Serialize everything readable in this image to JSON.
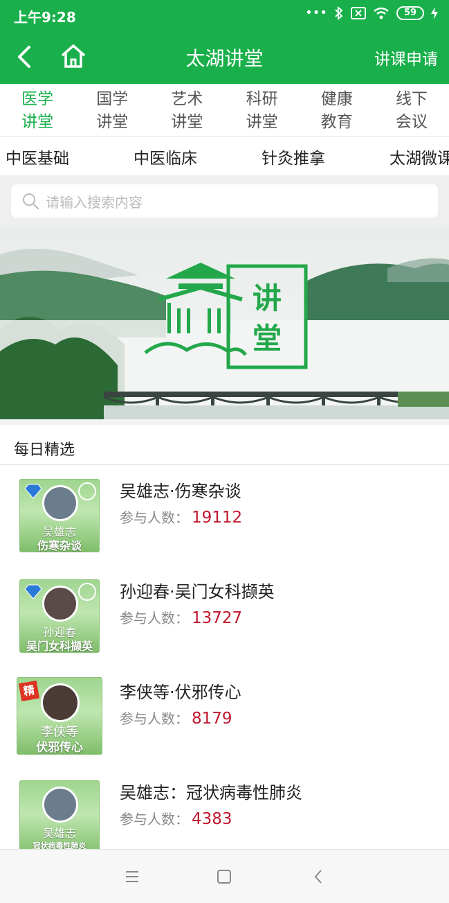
{
  "status_bar": {
    "time": "上午9:28",
    "battery": "59"
  },
  "header": {
    "title": "太湖讲堂",
    "apply_label": "讲课申请"
  },
  "category_tabs": [
    {
      "line1": "医学",
      "line2": "讲堂",
      "active": true
    },
    {
      "line1": "国学",
      "line2": "讲堂",
      "active": false
    },
    {
      "line1": "艺术",
      "line2": "讲堂",
      "active": false
    },
    {
      "line1": "科研",
      "line2": "讲堂",
      "active": false
    },
    {
      "line1": "健康",
      "line2": "教育",
      "active": false
    },
    {
      "line1": "线下",
      "line2": "会议",
      "active": false
    }
  ],
  "sub_tabs": [
    "中医基础",
    "中医临床",
    "针灸推拿",
    "太湖微课"
  ],
  "search": {
    "placeholder": "请输入搜索内容"
  },
  "banner": {
    "logo_text_1": "讲",
    "logo_text_2": "堂"
  },
  "section": {
    "title": "每日精选"
  },
  "items": [
    {
      "title": "吴雄志·伤寒杂谈",
      "stat_label": "参与人数：",
      "count": "19112",
      "thumb_name": "吴雄志",
      "thumb_topic": "伤寒杂谈"
    },
    {
      "title": "孙迎春·吴门女科撷英",
      "stat_label": "参与人数：",
      "count": "13727",
      "thumb_name": "孙迎春",
      "thumb_topic": "吴门女科撷英"
    },
    {
      "title": "李侠等·伏邪传心",
      "stat_label": "参与人数：",
      "count": "8179",
      "thumb_name": "李侠等",
      "thumb_topic": "伏邪传心",
      "badge": "精"
    },
    {
      "title": "吴雄志：冠状病毒性肺炎",
      "stat_label": "参与人数：",
      "count": "4383",
      "thumb_name": "吴雄志",
      "thumb_topic": "冠状病毒性肺炎"
    }
  ],
  "colors": {
    "brand_green": "#19b04b",
    "count_red": "#c0172f"
  }
}
